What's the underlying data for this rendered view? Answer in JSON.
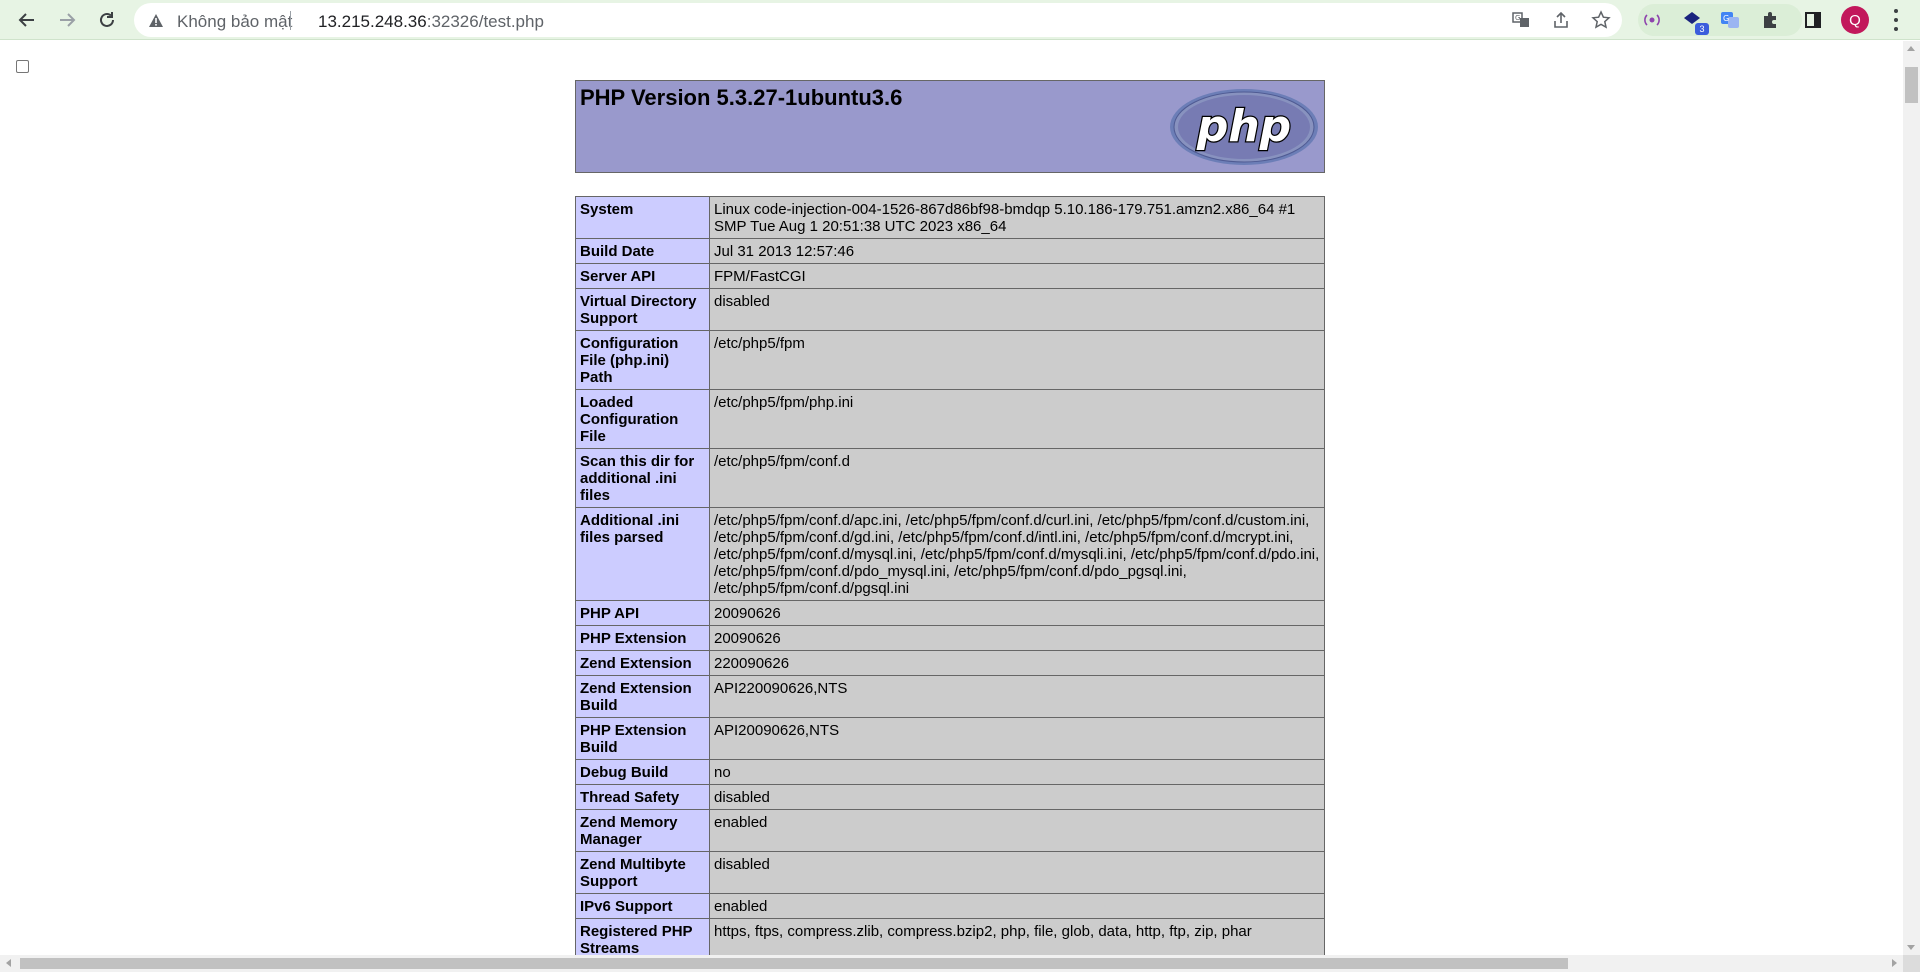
{
  "browser": {
    "not_secure_label": "Không bảo mật",
    "url_host": "13.215.248.36",
    "url_rest": ":32326/test.php",
    "profile_initial": "Q",
    "extension_badge": "3",
    "accent_color": "#e7f4e4",
    "icons": [
      "back-icon",
      "forward-icon",
      "reload-icon",
      "warning-icon",
      "translate-icon",
      "share-icon",
      "star-icon",
      "extension-icon",
      "puzzle-icon",
      "side-panel-icon",
      "menu-icon"
    ]
  },
  "phpinfo": {
    "title": "PHP Version 5.3.27-1ubuntu3.6",
    "logo_text": "php",
    "colors": {
      "header_bg": "#9999cc",
      "key_bg": "#ccccff",
      "value_bg": "#cccccc"
    },
    "rows": [
      {
        "key": "System",
        "value": "Linux code-injection-004-1526-867d86bf98-bmdqp 5.10.186-179.751.amzn2.x86_64 #1 SMP Tue Aug 1 20:51:38 UTC 2023 x86_64"
      },
      {
        "key": "Build Date",
        "value": "Jul 31 2013 12:57:46"
      },
      {
        "key": "Server API",
        "value": "FPM/FastCGI"
      },
      {
        "key": "Virtual Directory Support",
        "value": "disabled"
      },
      {
        "key": "Configuration File (php.ini) Path",
        "value": "/etc/php5/fpm"
      },
      {
        "key": "Loaded Configuration File",
        "value": "/etc/php5/fpm/php.ini"
      },
      {
        "key": "Scan this dir for additional .ini files",
        "value": "/etc/php5/fpm/conf.d"
      },
      {
        "key": "Additional .ini files parsed",
        "value": "/etc/php5/fpm/conf.d/apc.ini, /etc/php5/fpm/conf.d/curl.ini, /etc/php5/fpm/conf.d/custom.ini, /etc/php5/fpm/conf.d/gd.ini, /etc/php5/fpm/conf.d/intl.ini, /etc/php5/fpm/conf.d/mcrypt.ini, /etc/php5/fpm/conf.d/mysql.ini, /etc/php5/fpm/conf.d/mysqli.ini, /etc/php5/fpm/conf.d/pdo.ini, /etc/php5/fpm/conf.d/pdo_mysql.ini, /etc/php5/fpm/conf.d/pdo_pgsql.ini, /etc/php5/fpm/conf.d/pgsql.ini"
      },
      {
        "key": "PHP API",
        "value": "20090626"
      },
      {
        "key": "PHP Extension",
        "value": "20090626"
      },
      {
        "key": "Zend Extension",
        "value": "220090626"
      },
      {
        "key": "Zend Extension Build",
        "value": "API220090626,NTS"
      },
      {
        "key": "PHP Extension Build",
        "value": "API20090626,NTS"
      },
      {
        "key": "Debug Build",
        "value": "no"
      },
      {
        "key": "Thread Safety",
        "value": "disabled"
      },
      {
        "key": "Zend Memory Manager",
        "value": "enabled"
      },
      {
        "key": "Zend Multibyte Support",
        "value": "disabled"
      },
      {
        "key": "IPv6 Support",
        "value": "enabled"
      },
      {
        "key": "Registered PHP Streams",
        "value": "https, ftps, compress.zlib, compress.bzip2, php, file, glob, data, http, ftp, zip, phar"
      }
    ]
  }
}
